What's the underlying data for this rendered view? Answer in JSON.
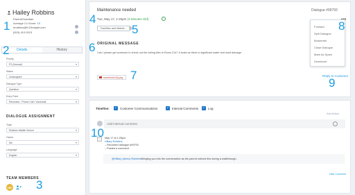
{
  "contact": {
    "name": "Hailey Robbins",
    "role": "Parent/Guardian",
    "score_label": "Average Cx Score:",
    "score_value": "10",
    "email": "hrobbins@K12insight.com",
    "phone": "(815) 410-0115"
  },
  "tabs": [
    "Details",
    "History"
  ],
  "fields": [
    {
      "label": "Priority",
      "value": "P2 (Normal)"
    },
    {
      "label": "Status",
      "value": "Unassigned"
    },
    {
      "label": "Dialogue Type",
      "value": "Question"
    },
    {
      "label": "Entry Point",
      "value": "Recorded - Phone Call / Voicemail"
    }
  ],
  "assignment": {
    "title": "DIALOGUE ASSIGNMENT",
    "fields": [
      {
        "label": "Topic",
        "value": "Robbins Middle School"
      },
      {
        "label": "Owner",
        "value": "Me"
      },
      {
        "label": "Language",
        "value": "English"
      }
    ]
  },
  "team": {
    "title": "TEAM MEMBERS",
    "avatar_initials": "HR"
  },
  "callouts": [
    "1",
    "2",
    "3",
    "4",
    "5",
    "6",
    "7",
    "8",
    "9",
    "10"
  ],
  "dialogue": {
    "title": "Maintenance needed",
    "id": "Dialogue #09793",
    "date": "Tue, May 17, 1:25pm",
    "elapsed": "(3 Minutes Old)",
    "tag": "Facilities and Mainte...",
    "original_title": "ORIGINAL MESSAGE",
    "original_body": "Can I please get someone to check out the ceiling tiles in Room 214? It looks as there is significant water and mold damage.",
    "attachment": "screenshot (5).png",
    "reply_label": "Reply to Customer",
    "more_label": "•••"
  },
  "menu": [
    "Forward",
    "Split Dialogue",
    "Bookmark",
    "Close Dialogue",
    "Mark As Spam",
    "Download"
  ],
  "timeline": {
    "label": "Timeline:",
    "filters": [
      "Customer Communications",
      "Internal Comments",
      "Log"
    ],
    "add_action": "Add Action",
    "comment_placeholder": "Add internal comment",
    "entry": {
      "time": "May 17 at 1:25pm",
      "author": "Hillary Robbins",
      "line1": "– Recorded dialogue #09793",
      "line2": "– Posted a comment",
      "mention_who": "@Hillary (demo) Robbins",
      "mention_text": " Bringing you into the conversation as the parent noticed this during a walkthrough."
    },
    "hide_comment": "Hide Comment"
  },
  "colors": {
    "accent": "#1a9be0",
    "link": "#1a73c7",
    "success": "#3aa157",
    "avatar": "#e6b73a"
  }
}
